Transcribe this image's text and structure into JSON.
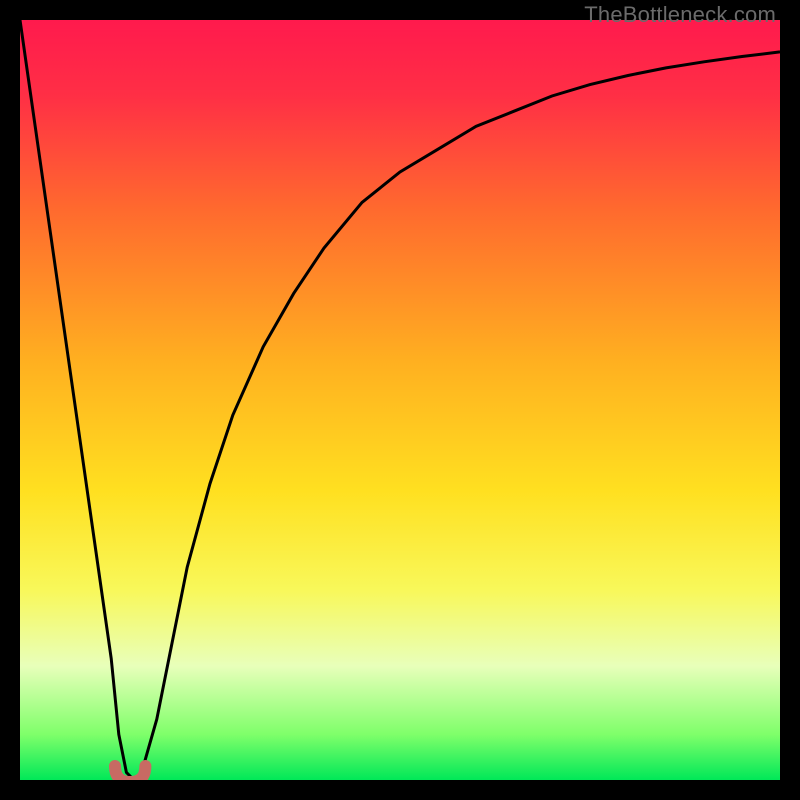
{
  "watermark": "TheBottleneck.com",
  "colors": {
    "bg": "#000000",
    "gradient_stops": [
      {
        "offset": 0.0,
        "color": "#ff1a4d"
      },
      {
        "offset": 0.1,
        "color": "#ff2f45"
      },
      {
        "offset": 0.25,
        "color": "#ff6a2e"
      },
      {
        "offset": 0.45,
        "color": "#ffb020"
      },
      {
        "offset": 0.62,
        "color": "#ffe020"
      },
      {
        "offset": 0.75,
        "color": "#f8f85a"
      },
      {
        "offset": 0.85,
        "color": "#e8ffba"
      },
      {
        "offset": 0.94,
        "color": "#7fff6a"
      },
      {
        "offset": 1.0,
        "color": "#00e858"
      }
    ],
    "curve": "#000000",
    "marker_fill": "#c86a63",
    "marker_stroke": "#c86a63"
  },
  "chart_data": {
    "type": "line",
    "title": "",
    "xlabel": "",
    "ylabel": "",
    "xlim": [
      0,
      100
    ],
    "ylim": [
      0,
      100
    ],
    "series": [
      {
        "name": "bottleneck-curve",
        "x": [
          0,
          2,
          4,
          6,
          8,
          10,
          12,
          13,
          14,
          15,
          16,
          18,
          20,
          22,
          25,
          28,
          32,
          36,
          40,
          45,
          50,
          55,
          60,
          65,
          70,
          75,
          80,
          85,
          90,
          95,
          100
        ],
        "y": [
          100,
          86,
          72,
          58,
          44,
          30,
          16,
          6,
          1,
          0,
          1,
          8,
          18,
          28,
          39,
          48,
          57,
          64,
          70,
          76,
          80,
          83,
          86,
          88,
          90,
          91.5,
          92.7,
          93.7,
          94.5,
          95.2,
          95.8
        ]
      }
    ],
    "marker": {
      "name": "optimal-region",
      "x_range": [
        12.5,
        16.5
      ],
      "y": 0,
      "estimate_label": "optimal point near x≈14–15, y≈0"
    }
  }
}
